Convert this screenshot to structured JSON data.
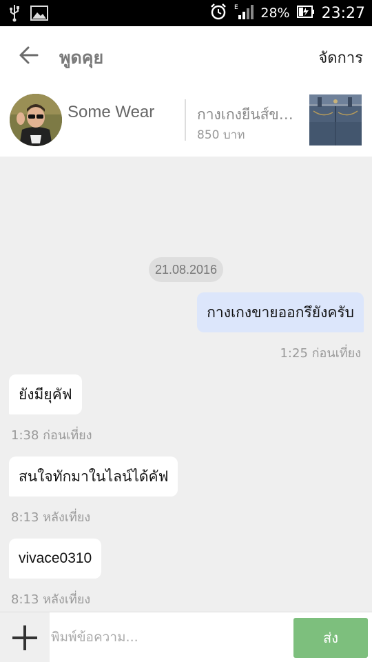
{
  "status_bar": {
    "battery": "28%",
    "time": "23:27",
    "icons": [
      "usb-icon",
      "image-icon",
      "alarm-icon",
      "signal-icon",
      "battery-icon"
    ]
  },
  "header": {
    "title": "พูดคุย",
    "manage": "จัดการ"
  },
  "product": {
    "seller": "Some Wear",
    "name": "กางเกงยีนส์ขายาว",
    "price": "850 บาท"
  },
  "chat": {
    "date": "21.08.2016",
    "messages": [
      {
        "text": "กางเกงขายออกรึยังครับ",
        "time": "1:25 ก่อนเที่ยง",
        "side": "out"
      },
      {
        "text": "ยังมียุคัฟ",
        "time": "1:38 ก่อนเที่ยง",
        "side": "in"
      },
      {
        "text": "สนใจทักมาในไลน์ได้คัฟ",
        "time": "8:13 หลังเที่ยง",
        "side": "in"
      },
      {
        "text": "vivace0310",
        "time": "8:13 หลังเที่ยง",
        "side": "in"
      }
    ]
  },
  "composer": {
    "placeholder": "พิมพ์ข้อความ...",
    "send": "ส่ง"
  },
  "colors": {
    "out_bubble": "#dce6fb",
    "in_bubble": "#ffffff",
    "send_button": "#7dbf7d",
    "chat_bg": "#efefef"
  }
}
